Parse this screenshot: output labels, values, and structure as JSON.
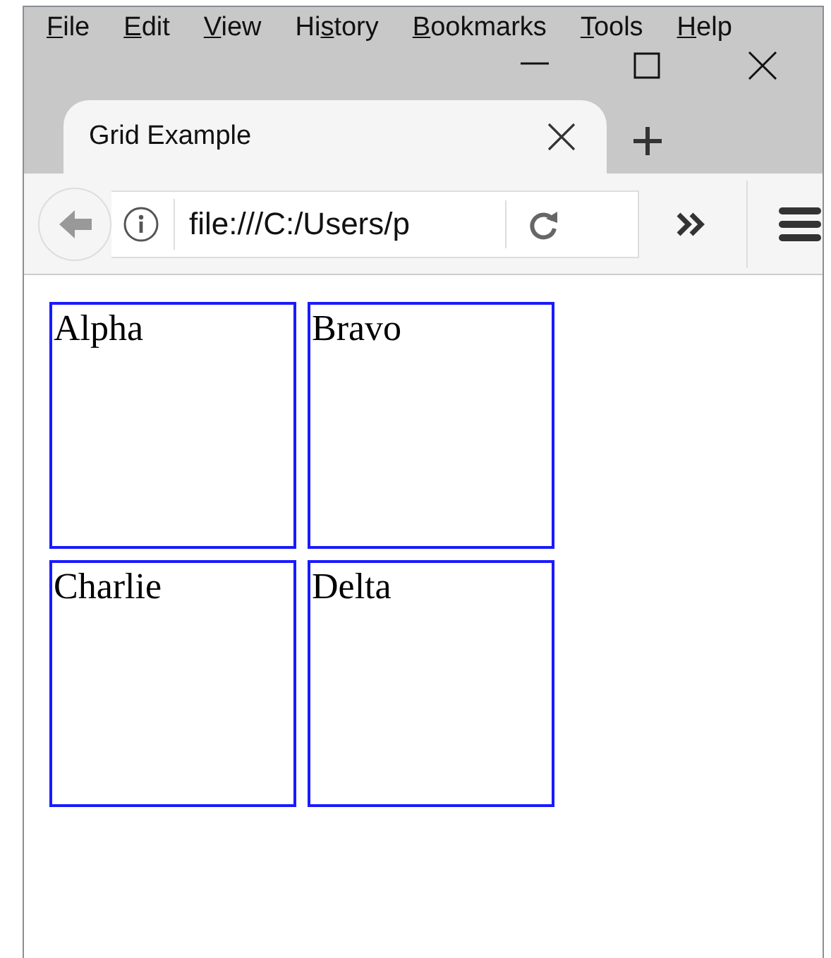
{
  "menu": [
    {
      "key": "F",
      "post": "ile"
    },
    {
      "key": "E",
      "post": "dit"
    },
    {
      "key": "V",
      "post": "iew"
    },
    {
      "pre": "Hi",
      "key": "s",
      "post": "tory"
    },
    {
      "key": "B",
      "post": "ookmarks"
    },
    {
      "key": "T",
      "post": "ools"
    },
    {
      "key": "H",
      "post": "elp"
    }
  ],
  "tabs": [
    {
      "title": "Grid Example",
      "selected": true
    }
  ],
  "address": {
    "value": "file:///C:/Users/p"
  },
  "cells": [
    "Alpha",
    "Bravo",
    "Charlie",
    "Delta"
  ]
}
